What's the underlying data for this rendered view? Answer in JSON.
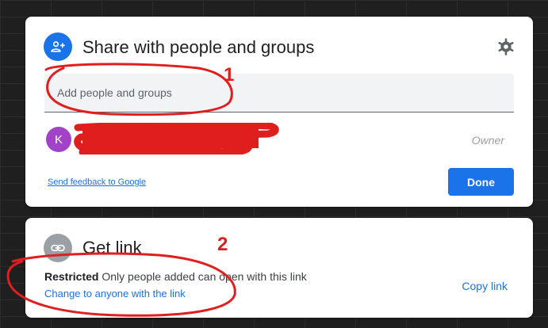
{
  "share_dialog": {
    "title": "Share with people and groups",
    "add_placeholder": "Add people and groups",
    "person": {
      "avatar_letter": "K",
      "name": "",
      "role": "Owner"
    },
    "feedback_link": "Send feedback to Google",
    "done_label": "Done",
    "icons": {
      "header": "add-person-icon",
      "settings": "gear-icon"
    }
  },
  "link_dialog": {
    "title": "Get link",
    "access_level": "Restricted",
    "access_description": "Only people added can open with this link",
    "change_link": "Change to anyone with the link",
    "copy_link": "Copy link",
    "icons": {
      "header": "link-icon"
    }
  },
  "annotations": {
    "marker_1": "1",
    "marker_2": "2",
    "color": "#e01e1e"
  },
  "colors": {
    "accent": "#1a73e8",
    "avatar": "#a142c9",
    "link_icon_bg": "#9aa0a6",
    "background": "#1f1f1f"
  }
}
